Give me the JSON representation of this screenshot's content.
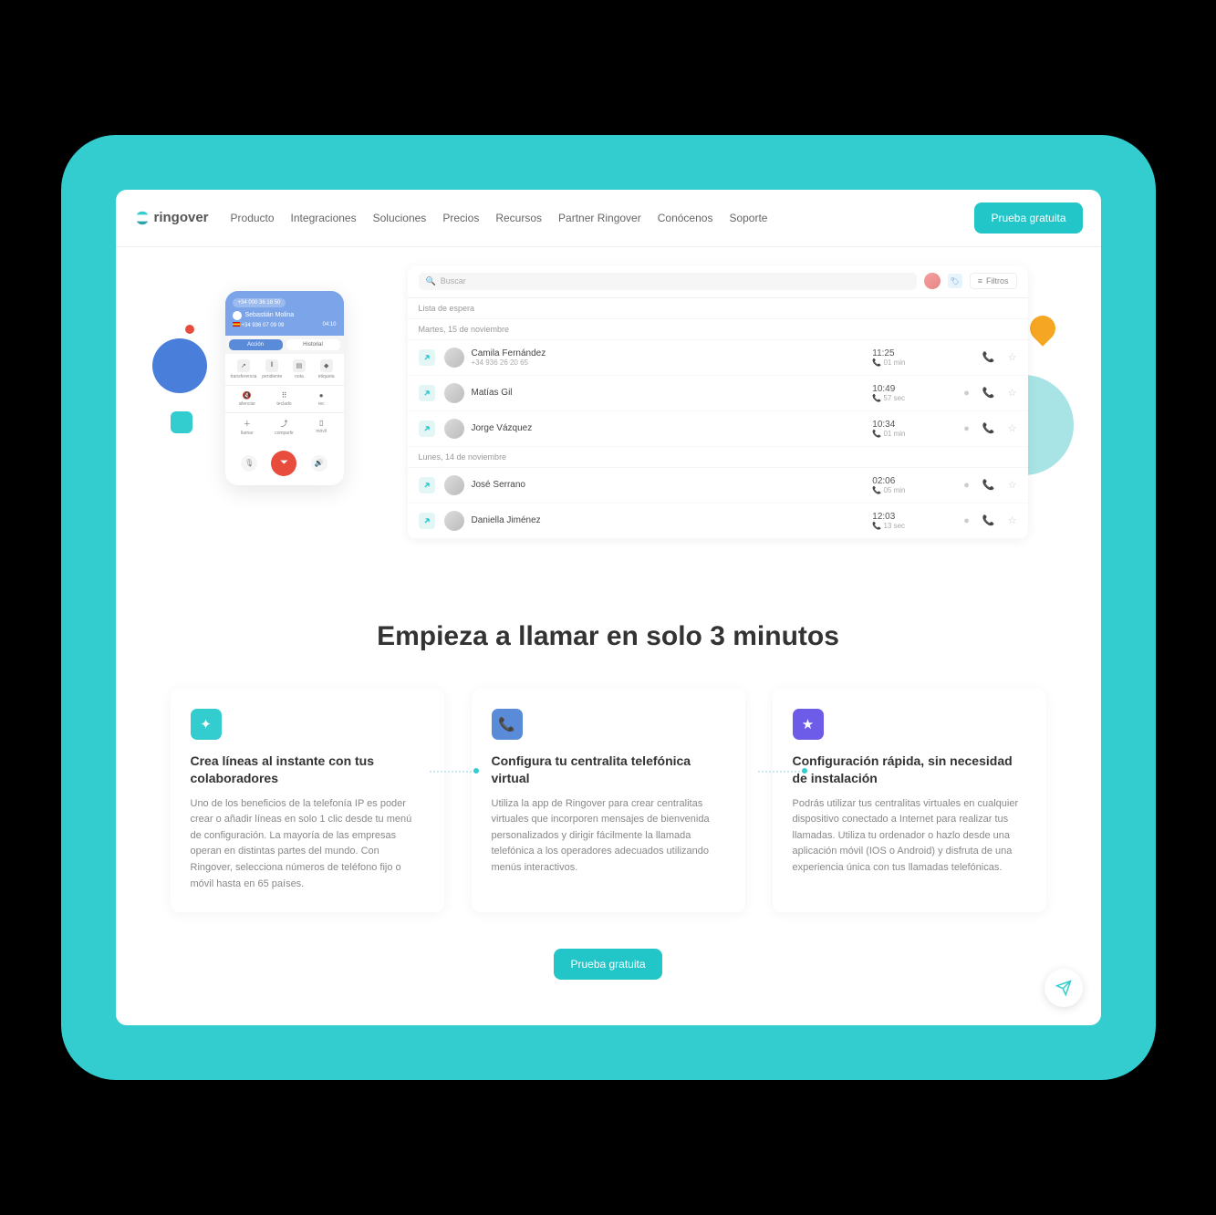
{
  "brand": "ringover",
  "nav": [
    "Producto",
    "Integraciones",
    "Soluciones",
    "Precios",
    "Recursos",
    "Partner Ringover",
    "Conócenos",
    "Soporte"
  ],
  "cta": "Prueba gratuita",
  "phone": {
    "badge": "+34 000 36 18 50",
    "name": "Sebastián Molina",
    "number": "+34 936 07 09 09",
    "time": "04:10",
    "tabs": [
      "Acción",
      "Historial"
    ],
    "row1": [
      "transferencia",
      "pendiente",
      "nota",
      "etiqueta"
    ],
    "row2": [
      "silenciar",
      "teclado",
      "rec"
    ],
    "row3": [
      "llamar",
      "compartir",
      "móvil"
    ]
  },
  "callList": {
    "searchPlaceholder": "Buscar",
    "filters": "Filtros",
    "waitlist": "Lista de espera",
    "sections": [
      {
        "label": "Martes, 15 de noviembre",
        "calls": [
          {
            "name": "Camila Fernández",
            "sub": "+34 936 26 20 65",
            "time": "11:25",
            "dur": "01 min",
            "hasDot": false
          },
          {
            "name": "Matías Gil",
            "sub": "",
            "time": "10:49",
            "dur": "57 sec",
            "hasDot": true
          },
          {
            "name": "Jorge Vázquez",
            "sub": "",
            "time": "10:34",
            "dur": "01 min",
            "hasDot": true
          }
        ]
      },
      {
        "label": "Lunes, 14 de noviembre",
        "calls": [
          {
            "name": "José Serrano",
            "sub": "",
            "time": "02:06",
            "dur": "05 min",
            "hasDot": true
          },
          {
            "name": "Daniella Jiménez",
            "sub": "",
            "time": "12:03",
            "dur": "13 sec",
            "hasDot": true
          }
        ]
      }
    ]
  },
  "sectionTitle": "Empieza a llamar en solo 3 minutos",
  "cards": [
    {
      "iconClass": "teal",
      "icon": "✦",
      "title": "Crea líneas al instante con tus colaboradores",
      "desc": "Uno de los beneficios de la telefonía IP es poder crear o añadir líneas en solo 1 clic desde tu menú de configuración. La mayoría de las empresas operan en distintas partes del mundo. Con Ringover, selecciona números de teléfono fijo o móvil hasta en 65 países."
    },
    {
      "iconClass": "blue",
      "icon": "📞",
      "title": "Configura tu centralita telefónica virtual",
      "desc": "Utiliza la app de Ringover para crear centralitas virtuales que incorporen mensajes de bienvenida personalizados y dirigir fácilmente la llamada telefónica a los operadores adecuados utilizando menús interactivos."
    },
    {
      "iconClass": "purple",
      "icon": "★",
      "title": "Configuración rápida, sin necesidad de instalación",
      "desc": "Podrás utilizar tus centralitas virtuales en cualquier dispositivo conectado a Internet para realizar tus llamadas. Utiliza tu ordenador o hazlo desde una aplicación móvil (IOS o Android) y disfruta de una experiencia única con tus llamadas telefónicas."
    }
  ]
}
